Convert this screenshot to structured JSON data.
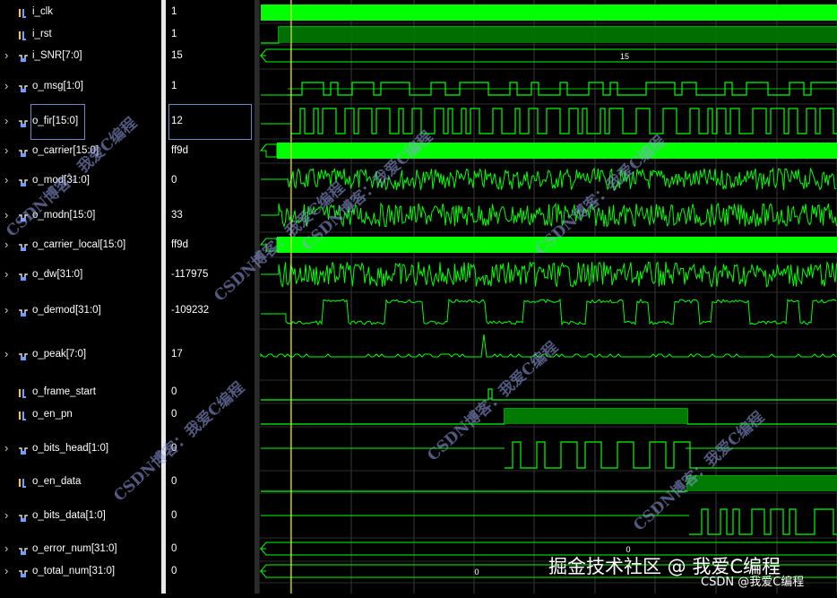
{
  "signals": [
    {
      "name": "i_clk",
      "value": "1",
      "type": "bit",
      "expandable": false
    },
    {
      "name": "i_rst",
      "value": "1",
      "type": "bit",
      "expandable": false
    },
    {
      "name": "i_SNR[7:0]",
      "value": "15",
      "type": "bus",
      "expandable": true
    },
    {
      "name": "o_msg[1:0]",
      "value": "1",
      "type": "bus",
      "expandable": true
    },
    {
      "name": "o_fir[15:0]",
      "value": "12",
      "type": "bus",
      "expandable": true
    },
    {
      "name": "o_carrier[15:0]",
      "value": "ff9d",
      "type": "bus",
      "expandable": true
    },
    {
      "name": "o_mod[31:0]",
      "value": "0",
      "type": "bus",
      "expandable": true
    },
    {
      "name": "o_modn[15:0]",
      "value": "33",
      "type": "bus",
      "expandable": true
    },
    {
      "name": "o_carrier_local[15:0]",
      "value": "ff9d",
      "type": "bus",
      "expandable": true
    },
    {
      "name": "o_dw[31:0]",
      "value": "-117975",
      "type": "bus",
      "expandable": true
    },
    {
      "name": "o_demod[31:0]",
      "value": "-109232",
      "type": "bus",
      "expandable": true
    },
    {
      "name": "o_peak[7:0]",
      "value": "17",
      "type": "bus",
      "expandable": true
    },
    {
      "name": "o_frame_start",
      "value": "0",
      "type": "bit",
      "expandable": false
    },
    {
      "name": "o_en_pn",
      "value": "0",
      "type": "bit",
      "expandable": false
    },
    {
      "name": "o_bits_head[1:0]",
      "value": "0",
      "type": "bus",
      "expandable": true
    },
    {
      "name": "o_en_data",
      "value": "0",
      "type": "bit",
      "expandable": false
    },
    {
      "name": "o_bits_data[1:0]",
      "value": "0",
      "type": "bus",
      "expandable": true
    },
    {
      "name": "o_error_num[31:0]",
      "value": "0",
      "type": "bus",
      "expandable": true
    },
    {
      "name": "o_total_num[31:0]",
      "value": "0",
      "type": "bus",
      "expandable": true
    }
  ],
  "bus_labels": {
    "snr": "15",
    "error_num": "0",
    "total_num": "0"
  },
  "colors": {
    "wave": "#00ff00",
    "wave_fill": "#007a00",
    "grid": "#8a8a8a",
    "cursor": "#ffff66",
    "background": "#000000"
  },
  "watermarks": [
    "CSDN博客：我爱C编程",
    "CSDN博客：我爱C编程",
    "CSDN博客：我爱C编程",
    "CSDN博客：我爱C编程",
    "CSDN博客：我爱C编程",
    "CSDN博客：我爱C编程",
    "CSDN博客：我爱C编程"
  ],
  "footer": {
    "site": "掘金技术社区 @ 我爱C编程",
    "csdn": "CSDN @我爱C编程"
  }
}
